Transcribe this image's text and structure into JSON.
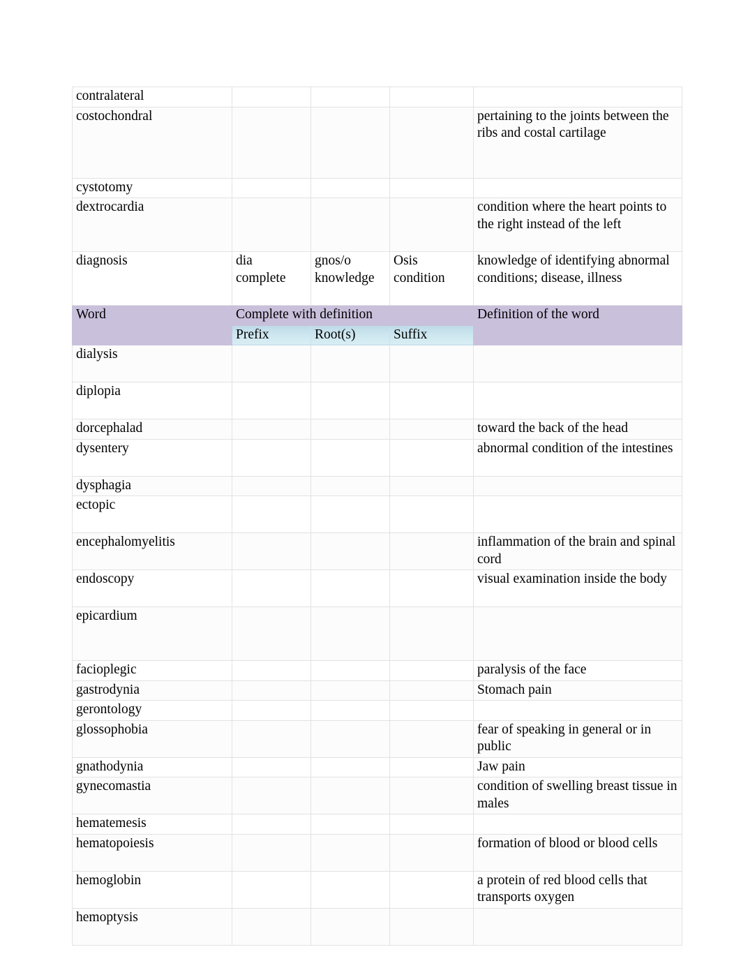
{
  "document": {
    "table": {
      "columns": [
        "Word",
        "Prefix",
        "Root(s)",
        "Suffix",
        "Definition of the word"
      ],
      "header_main": {
        "word": "Word",
        "complete": "Complete with definition",
        "definition": "Definition of the word"
      },
      "header_sub": {
        "prefix": "Prefix",
        "root": "Root(s)",
        "suffix": "Suffix"
      },
      "colors": {
        "header_lavender": "#c9c0dc",
        "header_cyan": "#cce6ef",
        "grid_line": "#e2e2e2",
        "cell_background": "#fcfcfc",
        "text": "#000000"
      },
      "rows_top": [
        {
          "word": "contralateral",
          "prefix": "",
          "root": "",
          "suffix": "",
          "definition": ""
        },
        {
          "word": "costochondral",
          "prefix": "",
          "root": "",
          "suffix": "",
          "definition": "pertaining to the joints between the ribs and costal cartilage"
        },
        {
          "word": "cystotomy",
          "prefix": "",
          "root": "",
          "suffix": "",
          "definition": ""
        },
        {
          "word": "dextrocardia",
          "prefix": "",
          "root": "",
          "suffix": "",
          "definition": "condition where the heart points to the right instead of the left"
        },
        {
          "word": "diagnosis",
          "prefix": "dia\ncomplete",
          "root": "gnos/o\nknowledge",
          "suffix": "Osis\ncondition",
          "definition": "knowledge of identifying abnormal conditions; disease, illness"
        }
      ],
      "rows_bottom": [
        {
          "word": "dialysis",
          "prefix": "",
          "root": "",
          "suffix": "",
          "definition": ""
        },
        {
          "word": "diplopia",
          "prefix": "",
          "root": "",
          "suffix": "",
          "definition": ""
        },
        {
          "word": "dorcephalad",
          "prefix": "",
          "root": "",
          "suffix": "",
          "definition": "toward the back of the head"
        },
        {
          "word": "dysentery",
          "prefix": "",
          "root": "",
          "suffix": "",
          "definition": "abnormal condition of the intestines"
        },
        {
          "word": "dysphagia",
          "prefix": "",
          "root": "",
          "suffix": "",
          "definition": ""
        },
        {
          "word": "ectopic",
          "prefix": "",
          "root": "",
          "suffix": "",
          "definition": ""
        },
        {
          "word": "encephalomyelitis",
          "prefix": "",
          "root": "",
          "suffix": "",
          "definition": "inflammation of the brain and spinal cord"
        },
        {
          "word": "endoscopy",
          "prefix": "",
          "root": "",
          "suffix": "",
          "definition": "visual examination inside the body"
        },
        {
          "word": "epicardium",
          "prefix": "",
          "root": "",
          "suffix": "",
          "definition": ""
        },
        {
          "word": "facioplegic",
          "prefix": "",
          "root": "",
          "suffix": "",
          "definition": "paralysis of the face"
        },
        {
          "word": "gastrodynia",
          "prefix": "",
          "root": "",
          "suffix": "",
          "definition": "Stomach pain"
        },
        {
          "word": "gerontology",
          "prefix": "",
          "root": "",
          "suffix": "",
          "definition": ""
        },
        {
          "word": "glossophobia",
          "prefix": "",
          "root": "",
          "suffix": "",
          "definition": "fear of speaking in general or in public"
        },
        {
          "word": "gnathodynia",
          "prefix": "",
          "root": "",
          "suffix": "",
          "definition": "Jaw pain"
        },
        {
          "word": "gynecomastia",
          "prefix": "",
          "root": "",
          "suffix": "",
          "definition": "condition of swelling breast tissue in males"
        },
        {
          "word": "hematemesis",
          "prefix": "",
          "root": "",
          "suffix": "",
          "definition": ""
        },
        {
          "word": "hematopoiesis",
          "prefix": "",
          "root": "",
          "suffix": "",
          "definition": "formation of blood or blood cells"
        },
        {
          "word": "hemoglobin",
          "prefix": "",
          "root": "",
          "suffix": "",
          "definition": "a protein of red blood cells that transports oxygen"
        },
        {
          "word": "hemoptysis",
          "prefix": "",
          "root": "",
          "suffix": "",
          "definition": ""
        }
      ]
    }
  }
}
